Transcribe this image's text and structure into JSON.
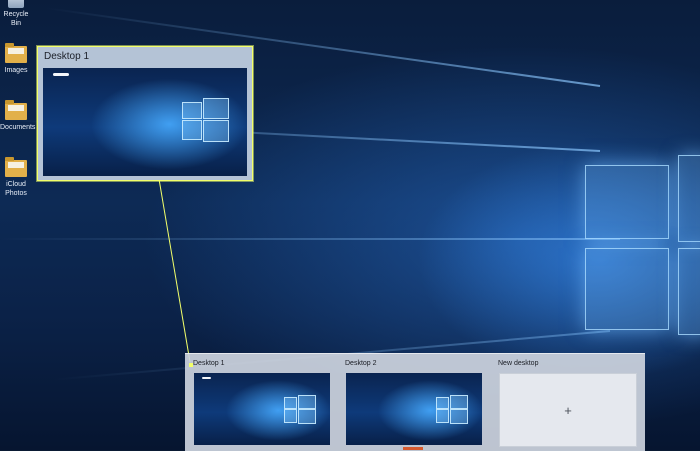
{
  "desktop_icons": [
    {
      "name": "Recycle Bin",
      "icon": "recycle-bin-icon"
    },
    {
      "name": "Images",
      "icon": "folder-icon"
    },
    {
      "name": "Documents",
      "icon": "folder-icon"
    },
    {
      "name": "iCloud\nPhotos",
      "icon": "folder-icon"
    }
  ],
  "preview": {
    "title": "Desktop 1"
  },
  "task_view": {
    "desktops": [
      {
        "label": "Desktop 1"
      },
      {
        "label": "Desktop 2"
      }
    ],
    "new_desktop": {
      "label": "New desktop",
      "icon": "+"
    }
  },
  "colors": {
    "highlight": "#f2ff6a",
    "wallpaper": "#0d2a55",
    "task_view_bg": "#cdd4de",
    "indicator": "#d65a2f"
  }
}
